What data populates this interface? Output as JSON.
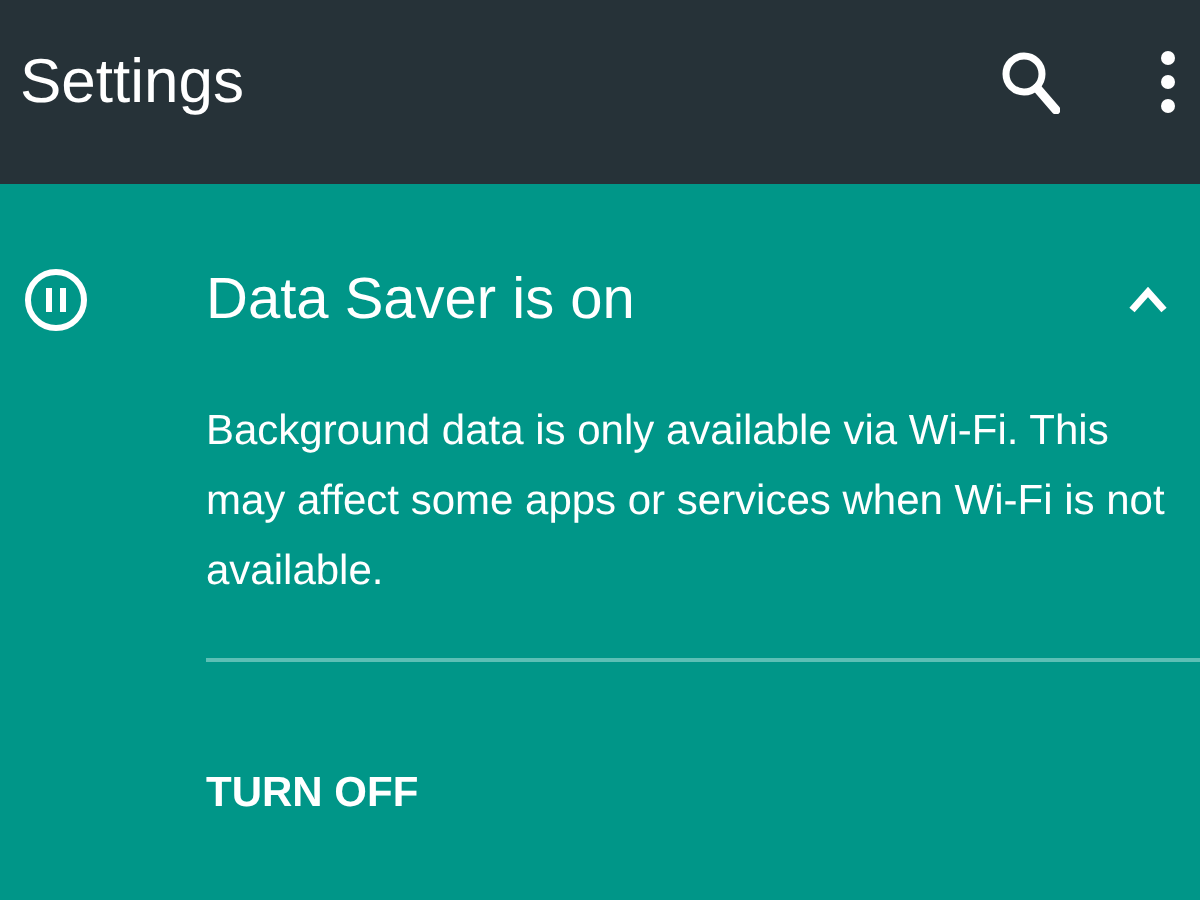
{
  "app_bar": {
    "title": "Settings"
  },
  "data_saver_card": {
    "title": "Data Saver is on",
    "expanded": true,
    "message": "Background data is only available via Wi-Fi. This may affect some apps or services when Wi-Fi is not available.",
    "action": "TURN OFF"
  }
}
